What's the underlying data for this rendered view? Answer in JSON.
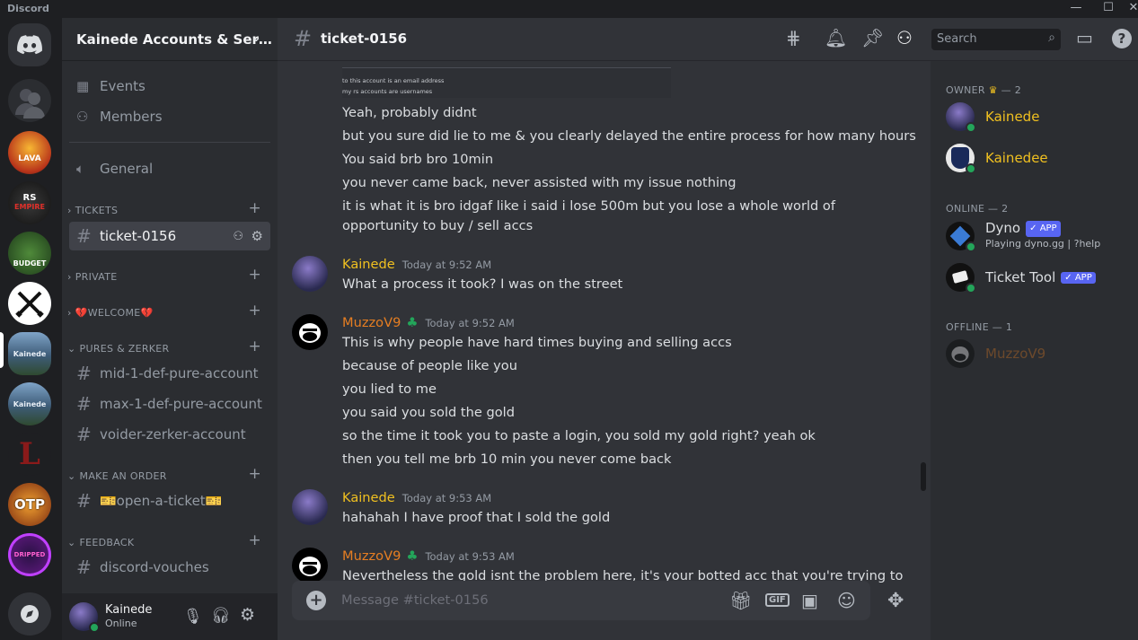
{
  "app": {
    "name": "Discord"
  },
  "guild": {
    "name": "Kainede Accounts & Ser…"
  },
  "top_nav": {
    "events": "Events",
    "members": "Members",
    "general": "General"
  },
  "categories": [
    {
      "name": "TICKETS"
    },
    {
      "name": "PRIVATE"
    },
    {
      "name": "💔WELCOME💔"
    },
    {
      "name": "PURES & ZERKER"
    },
    {
      "name": "MAKE AN ORDER"
    },
    {
      "name": "FEEDBACK"
    }
  ],
  "channels": {
    "ticket": "ticket-0156",
    "mid_pure": "mid-1-def-pure-account",
    "max_pure": "max-1-def-pure-account",
    "voider": "voider-zerker-account",
    "open_ticket": "🎫open-a-ticket🎫",
    "vouches": "discord-vouches"
  },
  "user": {
    "name": "Kainede",
    "status": "Online"
  },
  "header": {
    "channel": "ticket-0156",
    "search_placeholder": "Search"
  },
  "screenshot_lines": [
    "to this account is an email address",
    "my rs accounts are usernames"
  ],
  "messages": {
    "cont_lines": [
      "Yeah, probably didnt",
      "but you sure did lie to me & you clearly delayed the entire process for how many hours",
      "You said brb bro 10min",
      "you never came back, never assisted with my issue nothing",
      "it is what it is bro idgaf like i said i lose 500m but you lose a whole world of",
      "opportunity to buy / sell accs"
    ],
    "m1": {
      "author": "Kainede",
      "time": "Today at 9:52 AM",
      "lines": [
        "What a process it took? I was on the street"
      ]
    },
    "m2": {
      "author": "MuzzoV9",
      "time": "Today at 9:52 AM",
      "lines": [
        "This is why people have hard times buying and selling accs",
        "because of people like you",
        "you lied to me",
        "you said you sold the gold",
        "so the time it took you to paste a login, you sold my gold right? yeah ok",
        "then you tell me brb 10 min you never come back"
      ]
    },
    "m3": {
      "author": "Kainede",
      "time": "Today at 9:53 AM",
      "lines": [
        "hahahah I have proof that I sold the gold"
      ]
    },
    "m4": {
      "author": "MuzzoV9",
      "time": "Today at 9:53 AM",
      "lines": [
        "Nevertheless the gold isnt the problem here, it's your botted acc that you're trying to"
      ]
    }
  },
  "composer": {
    "placeholder": "Message #ticket-0156"
  },
  "member_list": {
    "owner_header": "OWNER",
    "owner_count": "— 2",
    "online_header": "ONLINE — 2",
    "offline_header": "OFFLINE — 1",
    "owners": [
      "Kainede",
      "Kainedee"
    ],
    "online": [
      {
        "name": "Dyno",
        "badge": "APP",
        "activity": "Playing dyno.gg | ?help"
      },
      {
        "name": "Ticket Tool",
        "badge": "APP"
      }
    ],
    "offline": [
      "MuzzoV9"
    ]
  },
  "colors": {
    "owner_name": "#f0c020",
    "muzzo_name": "#e67e22",
    "accent": "#5865f2",
    "online": "#23a55a"
  }
}
